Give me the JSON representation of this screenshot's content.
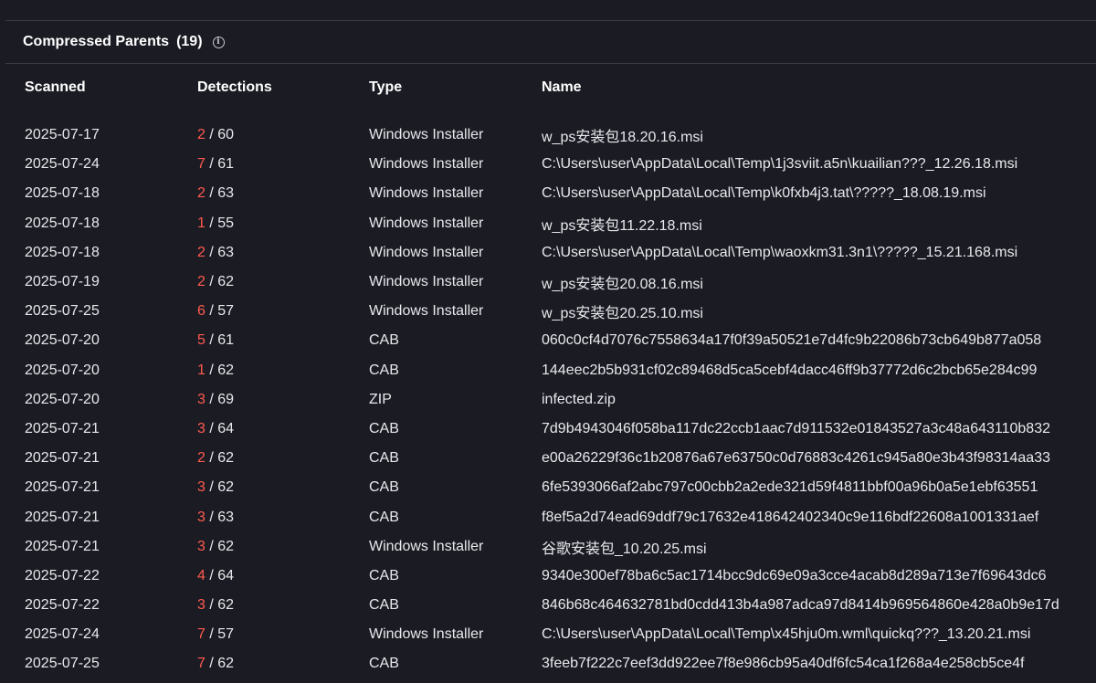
{
  "panel": {
    "title": "Compressed Parents",
    "count": "(19)",
    "info_icon": "info-icon"
  },
  "columns": {
    "scanned": "Scanned",
    "detections": "Detections",
    "type": "Type",
    "name": "Name"
  },
  "colors": {
    "background": "#1b1b24",
    "detection_positive": "#ff5a4e",
    "text": "#e8e8ec"
  },
  "rows": [
    {
      "scanned": "2025-07-17",
      "pos": "2",
      "total": "/ 60",
      "type": "Windows Installer",
      "name": "w_ps安装包18.20.16.msi"
    },
    {
      "scanned": "2025-07-24",
      "pos": "7",
      "total": "/ 61",
      "type": "Windows Installer",
      "name": "C:\\Users\\user\\AppData\\Local\\Temp\\1j3sviit.a5n\\kuailian???_12.26.18.msi"
    },
    {
      "scanned": "2025-07-18",
      "pos": "2",
      "total": "/ 63",
      "type": "Windows Installer",
      "name": "C:\\Users\\user\\AppData\\Local\\Temp\\k0fxb4j3.tat\\?????_18.08.19.msi"
    },
    {
      "scanned": "2025-07-18",
      "pos": "1",
      "total": "/ 55",
      "type": "Windows Installer",
      "name": "w_ps安装包11.22.18.msi"
    },
    {
      "scanned": "2025-07-18",
      "pos": "2",
      "total": "/ 63",
      "type": "Windows Installer",
      "name": "C:\\Users\\user\\AppData\\Local\\Temp\\waoxkm31.3n1\\?????_15.21.168.msi"
    },
    {
      "scanned": "2025-07-19",
      "pos": "2",
      "total": "/ 62",
      "type": "Windows Installer",
      "name": "w_ps安装包20.08.16.msi"
    },
    {
      "scanned": "2025-07-25",
      "pos": "6",
      "total": "/ 57",
      "type": "Windows Installer",
      "name": "w_ps安装包20.25.10.msi"
    },
    {
      "scanned": "2025-07-20",
      "pos": "5",
      "total": "/ 61",
      "type": "CAB",
      "name": "060c0cf4d7076c7558634a17f0f39a50521e7d4fc9b22086b73cb649b877a058"
    },
    {
      "scanned": "2025-07-20",
      "pos": "1",
      "total": "/ 62",
      "type": "CAB",
      "name": "144eec2b5b931cf02c89468d5ca5cebf4dacc46ff9b37772d6c2bcb65e284c99"
    },
    {
      "scanned": "2025-07-20",
      "pos": "3",
      "total": "/ 69",
      "type": "ZIP",
      "name": "infected.zip"
    },
    {
      "scanned": "2025-07-21",
      "pos": "3",
      "total": "/ 64",
      "type": "CAB",
      "name": "7d9b4943046f058ba117dc22ccb1aac7d911532e01843527a3c48a643110b832"
    },
    {
      "scanned": "2025-07-21",
      "pos": "2",
      "total": "/ 62",
      "type": "CAB",
      "name": "e00a26229f36c1b20876a67e63750c0d76883c4261c945a80e3b43f98314aa33"
    },
    {
      "scanned": "2025-07-21",
      "pos": "3",
      "total": "/ 62",
      "type": "CAB",
      "name": "6fe5393066af2abc797c00cbb2a2ede321d59f4811bbf00a96b0a5e1ebf63551"
    },
    {
      "scanned": "2025-07-21",
      "pos": "3",
      "total": "/ 63",
      "type": "CAB",
      "name": "f8ef5a2d74ead69ddf79c17632e418642402340c9e116bdf22608a1001331aef"
    },
    {
      "scanned": "2025-07-21",
      "pos": "3",
      "total": "/ 62",
      "type": "Windows Installer",
      "name": "谷歌安装包_10.20.25.msi"
    },
    {
      "scanned": "2025-07-22",
      "pos": "4",
      "total": "/ 64",
      "type": "CAB",
      "name": "9340e300ef78ba6c5ac1714bcc9dc69e09a3cce4acab8d289a713e7f69643dc6"
    },
    {
      "scanned": "2025-07-22",
      "pos": "3",
      "total": "/ 62",
      "type": "CAB",
      "name": "846b68c464632781bd0cdd413b4a987adca97d8414b969564860e428a0b9e17d"
    },
    {
      "scanned": "2025-07-24",
      "pos": "7",
      "total": "/ 57",
      "type": "Windows Installer",
      "name": "C:\\Users\\user\\AppData\\Local\\Temp\\x45hju0m.wml\\quickq???_13.20.21.msi"
    },
    {
      "scanned": "2025-07-25",
      "pos": "7",
      "total": "/ 62",
      "type": "CAB",
      "name": "3feeb7f222c7eef3dd922ee7f8e986cb95a40df6fc54ca1f268a4e258cb5ce4f"
    }
  ]
}
